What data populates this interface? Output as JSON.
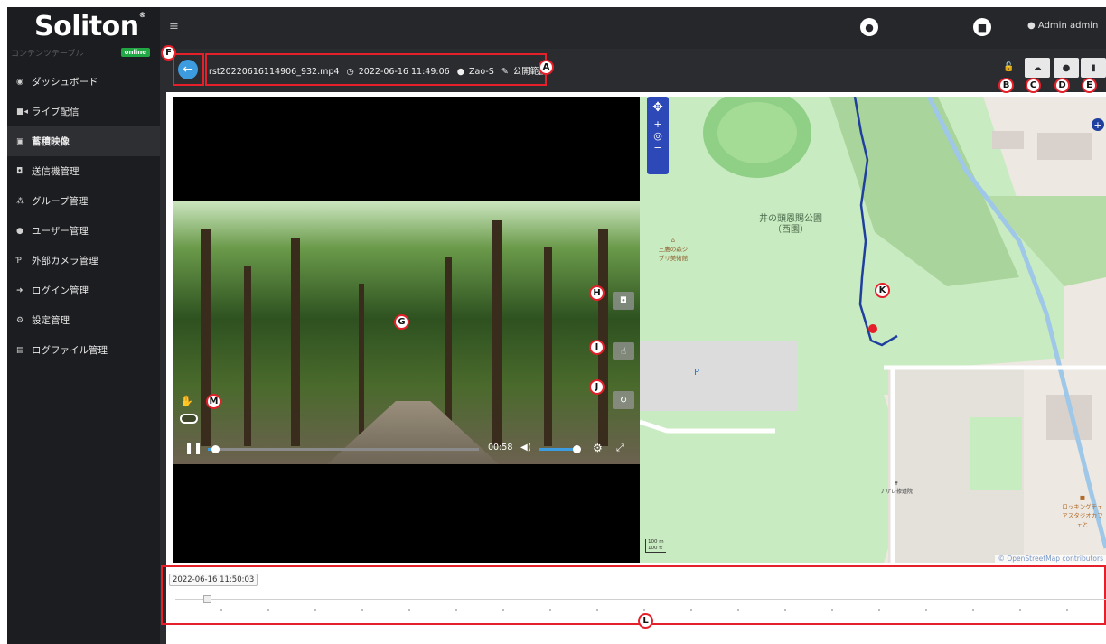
{
  "sidebar": {
    "logo": "Soliton",
    "logo_mark": "®",
    "subtitle": "コンテンツテーブル",
    "status_badge": "online",
    "items": [
      {
        "icon": "dashboard-icon",
        "label": "ダッシュボード"
      },
      {
        "icon": "video-camera-icon",
        "label": "ライブ配信"
      },
      {
        "icon": "video-icon",
        "label": "蓄積映像"
      },
      {
        "icon": "camera-icon",
        "label": "送信機管理"
      },
      {
        "icon": "users-icon",
        "label": "グループ管理"
      },
      {
        "icon": "user-icon",
        "label": "ユーザー管理"
      },
      {
        "icon": "external-camera-icon",
        "label": "外部カメラ管理"
      },
      {
        "icon": "login-icon",
        "label": "ログイン管理"
      },
      {
        "icon": "settings-icon",
        "label": "設定管理"
      },
      {
        "icon": "log-file-icon",
        "label": "ログファイル管理"
      }
    ]
  },
  "topbar": {
    "menu_icon": "≡",
    "user_label": "Admin admin"
  },
  "file_header": {
    "filename": "rst20220616114906_932.mp4",
    "datetime": "2022-06-16 11:49:06",
    "device": "Zao-S",
    "visibility": "公開範囲"
  },
  "player": {
    "timecode": "00:58"
  },
  "map": {
    "park_label": "井の頭恩賜公園（西園）",
    "museum_label": "三鷹の森ジブリ美術館",
    "parking_label": "P",
    "church_label": "ナザレ修道院",
    "cafe_label": "ロッキングチェアスタジオカフェと",
    "attribution": "© OpenStreetMap contributors",
    "scale_m": "100 m",
    "scale_ft": "100 ft"
  },
  "timeline": {
    "current": "2022-06-16 11:50:03"
  },
  "callouts": {
    "A": "A",
    "B": "B",
    "C": "C",
    "D": "D",
    "E": "E",
    "F": "F",
    "G": "G",
    "H": "H",
    "I": "I",
    "J": "J",
    "K": "K",
    "L": "L",
    "M": "M"
  },
  "colors": {
    "accent": "#3d9be0",
    "callout": "#e5202a",
    "route": "#1f3f9f",
    "online": "#22a745"
  }
}
